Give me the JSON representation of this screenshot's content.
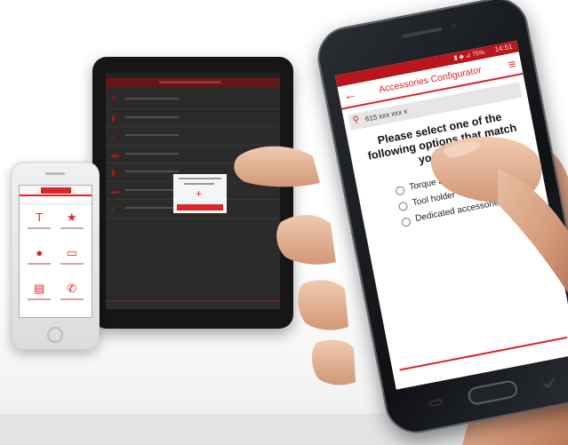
{
  "phone_app": {
    "status_time": "14:51",
    "status_icons": "▮ ◆ ⊿ 75%",
    "title": "Accessories Configurator",
    "search_value": "615 xxx xxx x",
    "prompt": "Please select one of the following options that match your need",
    "options": [
      {
        "label": "Torque arm"
      },
      {
        "label": "Tool holder"
      },
      {
        "label": "Dedicated accessories"
      }
    ],
    "icons": {
      "back": "arrow-left-icon",
      "menu": "hamburger-icon",
      "search": "search-icon"
    }
  },
  "tablet_icons": [
    "T",
    "▮",
    "╱",
    "▬",
    "▮",
    "▬",
    "╱"
  ],
  "iphone_icons": [
    "T",
    "★",
    "●",
    "▭",
    "▤",
    "✆"
  ],
  "colors": {
    "brand_red": "#d8262b",
    "status_red": "#b8161c"
  }
}
